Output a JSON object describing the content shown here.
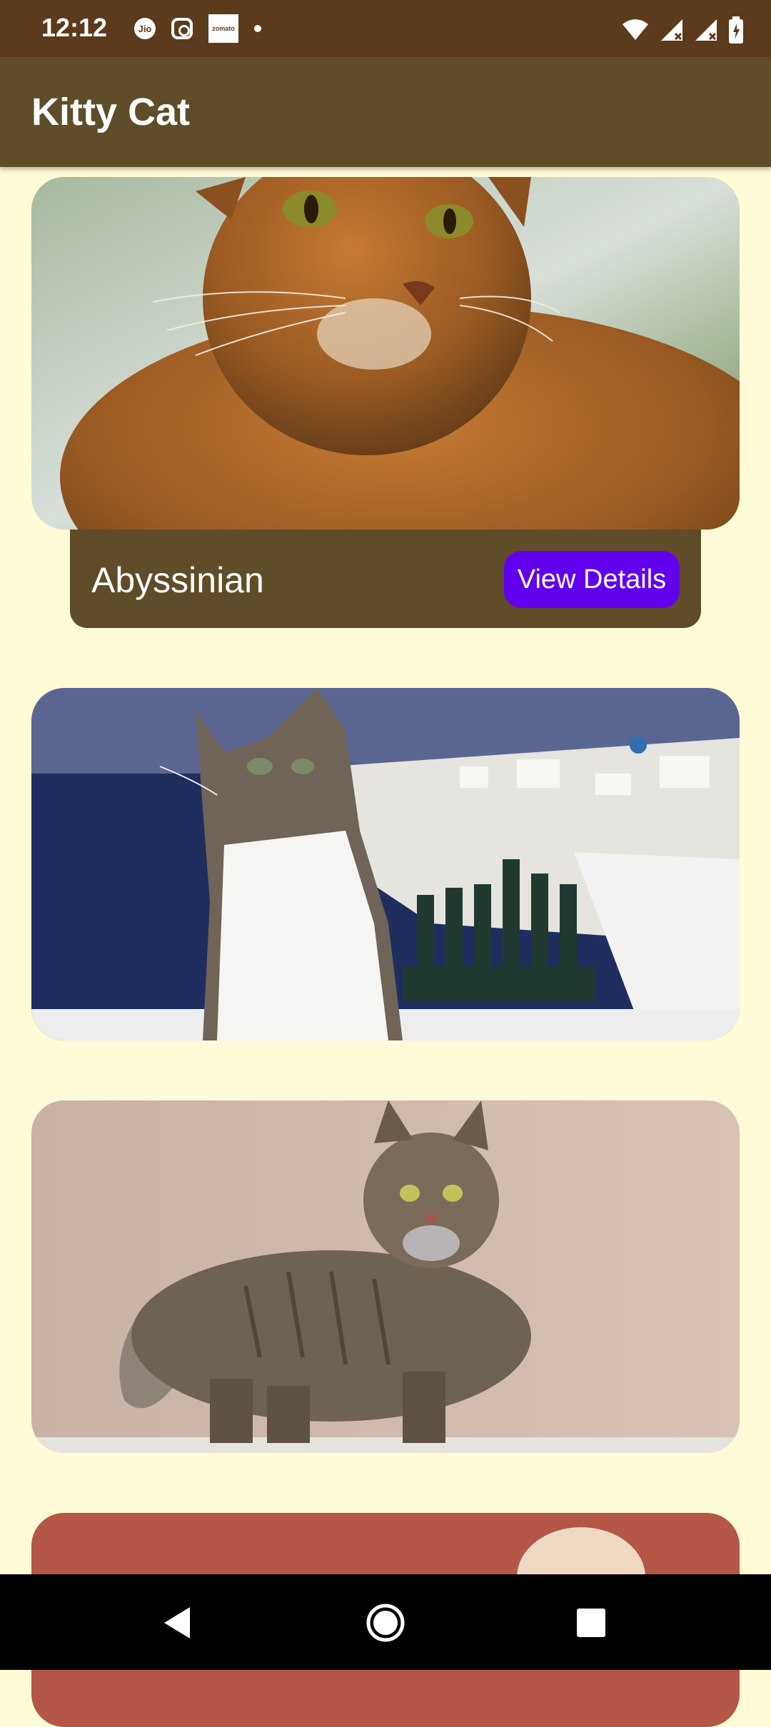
{
  "status_bar": {
    "time": "12:12",
    "left_icons": [
      "jio-icon",
      "instagram-icon",
      "zomato-icon",
      "notification-dot"
    ],
    "jio_label": "Jio",
    "zomato_label": "zomato",
    "right_icons": [
      "wifi-icon",
      "signal-icon",
      "signal-icon",
      "battery-icon"
    ],
    "background": "#5C3A1C"
  },
  "app_bar": {
    "title": "Kitty Cat",
    "background": "#5E4D28"
  },
  "cats": [
    {
      "name": "Abyssinian",
      "button_label": "View Details"
    },
    {
      "name": "",
      "button_label": ""
    },
    {
      "name": "",
      "button_label": ""
    },
    {
      "name": "",
      "button_label": ""
    }
  ],
  "colors": {
    "page_background": "#FFFBD6",
    "button": "#6200EE",
    "panel": "#5E4D28"
  },
  "nav_bar": {
    "buttons": [
      "back-icon",
      "home-icon",
      "recents-icon"
    ]
  }
}
